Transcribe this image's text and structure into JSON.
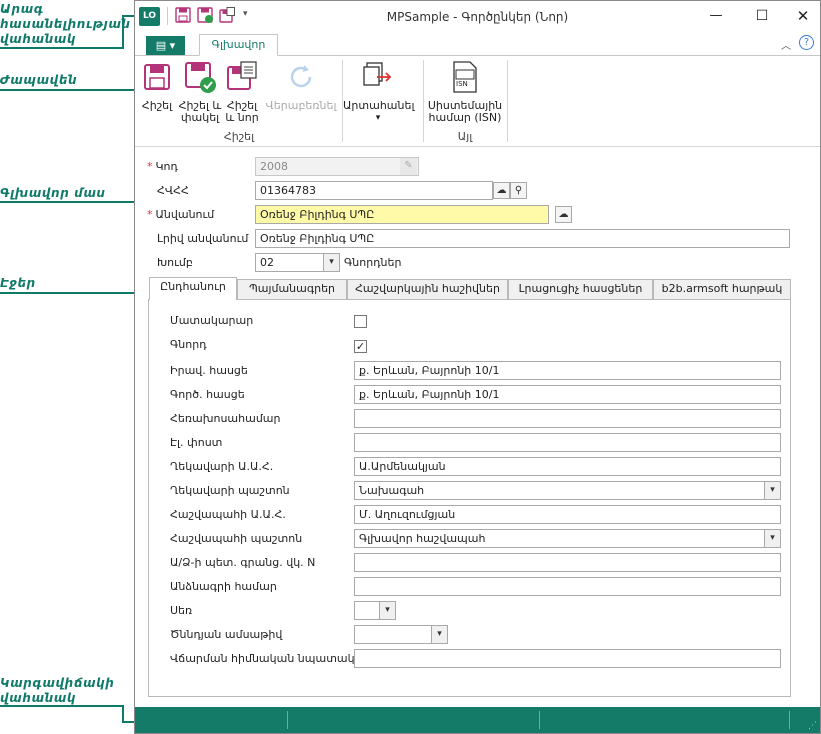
{
  "annotations": {
    "qat_area": "Արագ\nհասանելիության\nվահանակ",
    "ribbon": "Ժապավեն",
    "main_area": "Գլխավոր մաս",
    "tabs": "Էջեր",
    "status_bar": "Կարգավիճակի\nվահանակ"
  },
  "window": {
    "title": "MPSample - Գործընկեր (Նոր)",
    "app_icon_text": "LO"
  },
  "ribbon_tabs": {
    "file_label": "▤ ▾",
    "home_tab": "Գլխավոր"
  },
  "ribbon": {
    "save": "Հիշել",
    "save_close": "Հիշել և\nփակել",
    "save_new": "Հիշել\nև նոր",
    "restore": "Վերաբեռնել",
    "export": "Արտահանել",
    "export_arrow": "▾",
    "isn": "Սիստեմային\nհամար (ISN)",
    "isn_icon_text": "ISN",
    "group_save": "Հիշել",
    "group_other": "Այլ"
  },
  "form": {
    "code_label": "Կոդ",
    "code_value": "2008",
    "tin_label": "ՀՎՀՀ",
    "tin_value": "01364783",
    "name_label": "Անվանում",
    "name_value": "Օռենջ Բիլդինգ ՍՊԸ",
    "fullname_label": "Լրիվ անվանում",
    "fullname_value": "Օռենջ Բիլդինգ ՍՊԸ",
    "group_label": "Խումբ",
    "group_value": "02",
    "group_name": "Գնորդներ"
  },
  "tabs": [
    "Ընդհանուր",
    "Պայմանագրեր",
    "Հաշվարկային հաշիվներ",
    "Լրացուցիչ հասցեներ",
    "b2b.armsoft հարթակ"
  ],
  "general": {
    "supplier_label": "Մատակարար",
    "supplier_checked": false,
    "buyer_label": "Գնորդ",
    "buyer_checked": true,
    "legal_address_label": "Իրավ. հասցե",
    "legal_address_value": "ք. Երևան, Բայրոնի 10/1",
    "work_address_label": "Գործ. հասցե",
    "work_address_value": "ք. Երևան, Բայրոնի 10/1",
    "phone_label": "Հեռախոսահամար",
    "phone_value": "",
    "email_label": "Էլ. փոստ",
    "email_value": "",
    "director_label": "Ղեկավարի Ա.Ա.Հ.",
    "director_value": "Ա.Արմենակյան",
    "director_position_label": "Ղեկավարի պաշտոն",
    "director_position_value": "Նախագահ",
    "accountant_label": "Հաշվապահի Ա.Ա.Հ.",
    "accountant_value": "Մ. Աղուզումցյան",
    "accountant_position_label": "Հաշվապահի պաշտոն",
    "accountant_position_value": "Գլխավոր հաշվապահ",
    "reg_label": "Ա/Ձ-ի պետ. գրանց. վկ. N",
    "reg_value": "",
    "passport_label": "Անձնագրի համար",
    "passport_value": "",
    "gender_label": "Սեռ",
    "gender_value": "",
    "birthdate_label": "Ծննդյան ամսաթիվ",
    "birthdate_value": "  /  /",
    "purpose_label": "Վճարման հիմնական նպատակ",
    "purpose_value": ""
  }
}
